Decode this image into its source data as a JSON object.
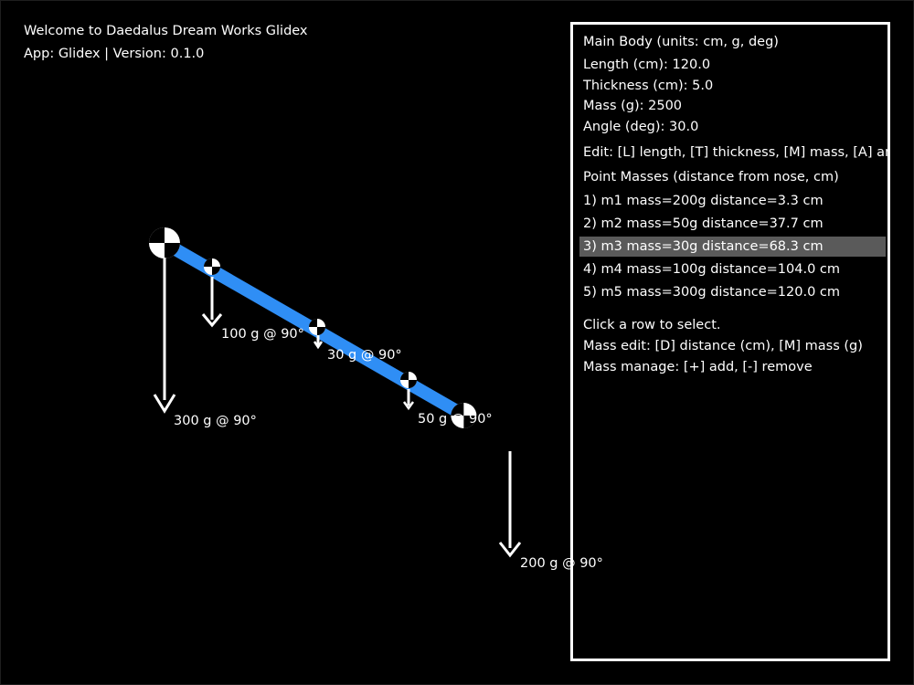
{
  "header": {
    "welcome": "Welcome to Daedalus Dream Works Glidex",
    "app_info": "App: Glidex | Version: 0.1.0"
  },
  "colors": {
    "background": "#000000",
    "body": "#2f8ef5",
    "text": "#ffffff",
    "selected_row": "#5a5a5a"
  },
  "model": {
    "length_cm": 120.0,
    "angle_deg": 30.0
  },
  "panel": {
    "title": "Main Body (units: cm, g, deg)",
    "length": "Length (cm): 120.0",
    "thickness": "Thickness (cm): 5.0",
    "mass": "Mass (g): 2500",
    "angle": "Angle (deg): 30.0",
    "edit_help": "Edit: [L] length, [T] thickness, [M] mass, [A] angle",
    "masses_title": "Point Masses (distance from nose, cm)",
    "rows": [
      "1) m1  mass=200g  distance=3.3 cm",
      "2) m2  mass=50g  distance=37.7 cm",
      "3) m3  mass=30g  distance=68.3 cm",
      "4) m4  mass=100g  distance=104.0 cm",
      "5) m5  mass=300g  distance=120.0 cm"
    ],
    "selected_index": 2,
    "click_hint": "Click a row to select.",
    "mass_edit": "Mass edit: [D] distance (cm), [M] mass (g)",
    "mass_manage": "Mass manage: [+] add, [-] remove"
  },
  "canvas_labels": [
    "300 g @ 90°",
    "100 g @ 90°",
    "30 g @ 90°",
    "50 g @ 90°",
    "200 g @ 90°"
  ]
}
